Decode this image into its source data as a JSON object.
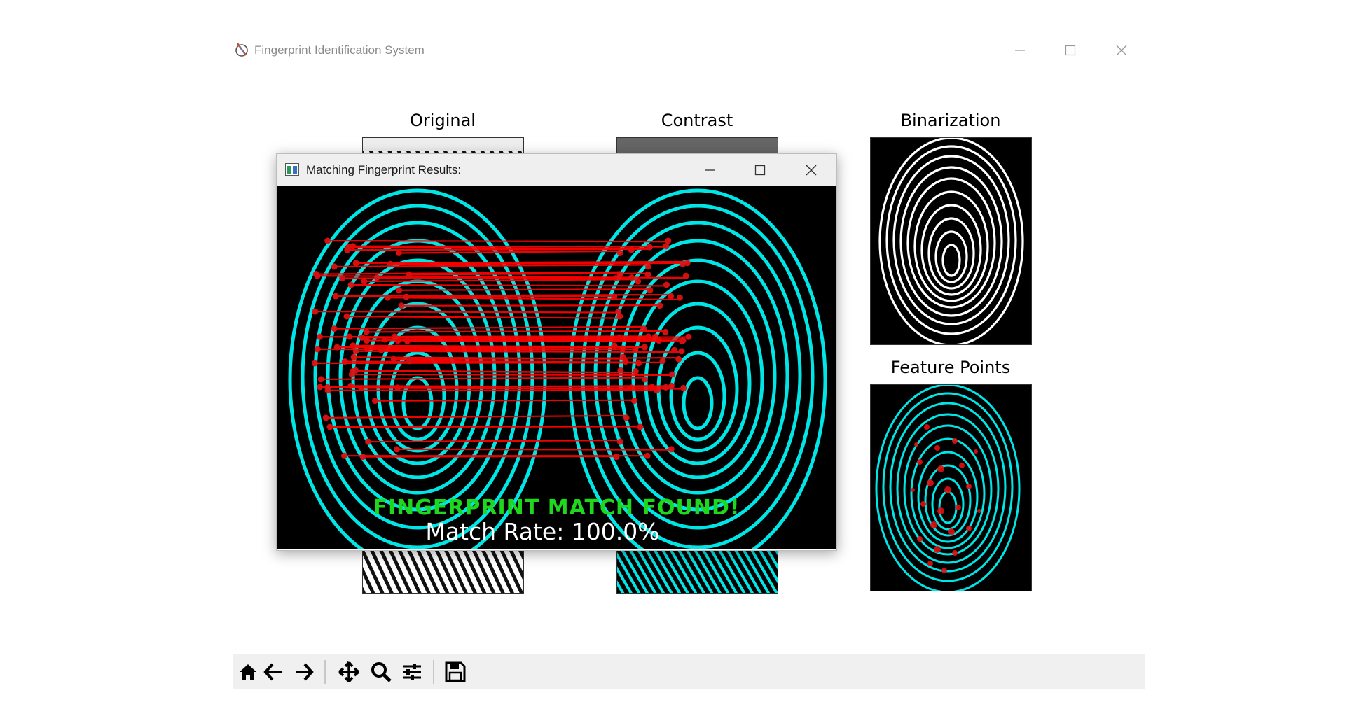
{
  "window": {
    "title": "Fingerprint Identification System",
    "minimize_icon": "minimize-icon",
    "maximize_icon": "maximize-icon",
    "close_icon": "close-icon"
  },
  "subplots": [
    {
      "title": "Original"
    },
    {
      "title": "Contrast"
    },
    {
      "title": "Binarization"
    },
    {
      "title": "Feature Points"
    }
  ],
  "toolbar": {
    "buttons": [
      "home-icon",
      "back-arrow-icon",
      "forward-arrow-icon",
      "pan-icon",
      "zoom-icon",
      "configure-subplots-icon",
      "save-icon"
    ]
  },
  "popup": {
    "title": "Matching Fingerprint Results:",
    "status": "FINGERPRINT MATCH FOUND!",
    "match_rate": "Match Rate: 100.0%"
  },
  "colors": {
    "ridge_cyan": "#00e5e5",
    "match_line_red": "#ff0000",
    "status_green": "#1ed81e",
    "toolbar_bg": "#f0f0f0"
  }
}
